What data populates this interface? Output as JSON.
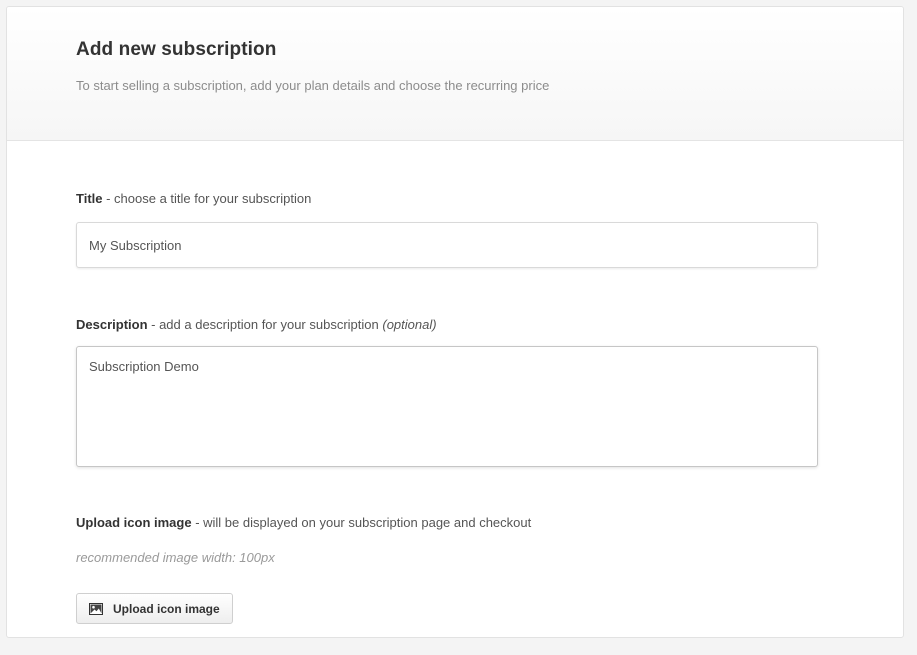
{
  "header": {
    "title": "Add new subscription",
    "subtitle": "To start selling a subscription, add your plan details and choose the recurring price"
  },
  "form": {
    "title_field": {
      "label_bold": "Title",
      "label_rest": " - choose a title for your subscription",
      "value": "My Subscription"
    },
    "description_field": {
      "label_bold": "Description",
      "label_rest": " - add a description for your subscription ",
      "label_optional": "(optional)",
      "value": "Subscription Demo"
    },
    "upload_field": {
      "label_bold": "Upload icon image",
      "label_rest": " - will be displayed on your subscription page and checkout",
      "hint": "recommended image width: 100px",
      "button_label": "Upload icon image",
      "button_icon": "image-icon"
    }
  },
  "colors": {
    "background": "#f4f4f4",
    "card": "#ffffff",
    "text": "#333333",
    "muted": "#8c8c8c"
  }
}
